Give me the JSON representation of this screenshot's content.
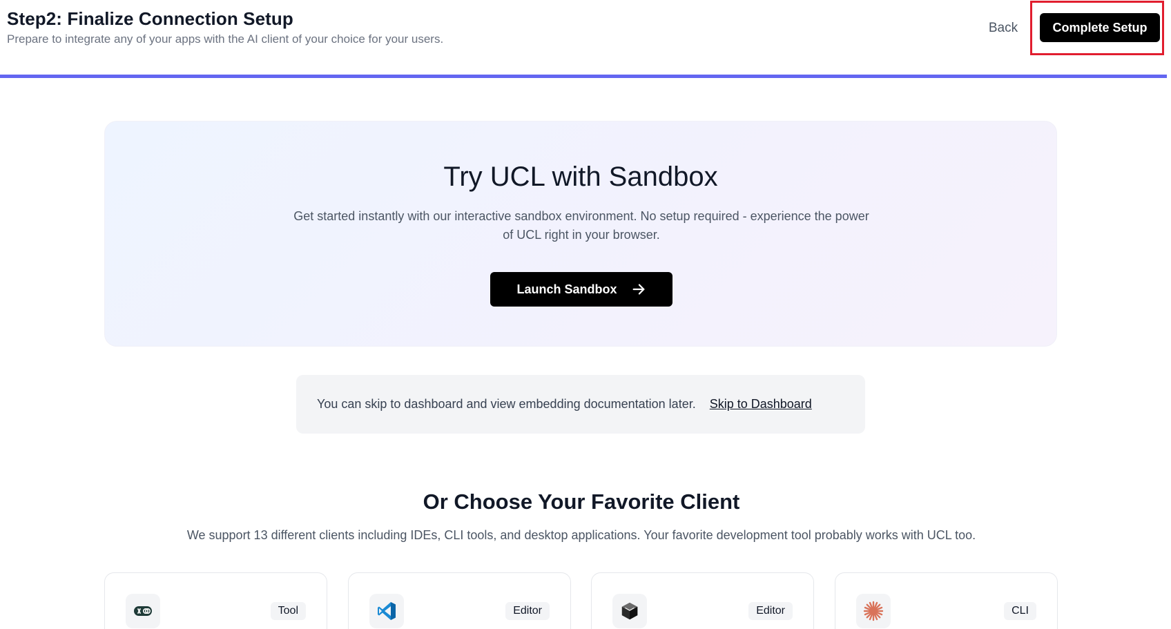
{
  "header": {
    "title": "Step2: Finalize Connection Setup",
    "subtitle": "Prepare to integrate any of your apps with the AI client of your choice for your users.",
    "back_label": "Back",
    "complete_label": "Complete Setup"
  },
  "progress": {
    "fraction": 1.0,
    "color": "#6366f1"
  },
  "sandbox": {
    "title": "Try UCL with Sandbox",
    "description": "Get started instantly with our interactive sandbox environment. No setup required - experience the power of UCL right in your browser.",
    "launch_label": "Launch Sandbox",
    "launch_icon": "arrow-right-icon"
  },
  "skip": {
    "text": "You can skip to dashboard and view embedding documentation later.",
    "link_label": "Skip to Dashboard"
  },
  "clients": {
    "title": "Or Choose Your Favorite Client",
    "description": "We support 13 different clients including IDEs, CLI tools, and desktop applications. Your favorite development tool probably works with UCL too.",
    "cards": [
      {
        "badge": "Tool",
        "icon": "toggle-link-icon"
      },
      {
        "badge": "Editor",
        "icon": "vscode-icon"
      },
      {
        "badge": "Editor",
        "icon": "cube-icon"
      },
      {
        "badge": "CLI",
        "icon": "starburst-icon"
      }
    ]
  },
  "colors": {
    "accent": "#6366f1",
    "highlight": "#e11d2e",
    "primary_button": "#000000"
  }
}
